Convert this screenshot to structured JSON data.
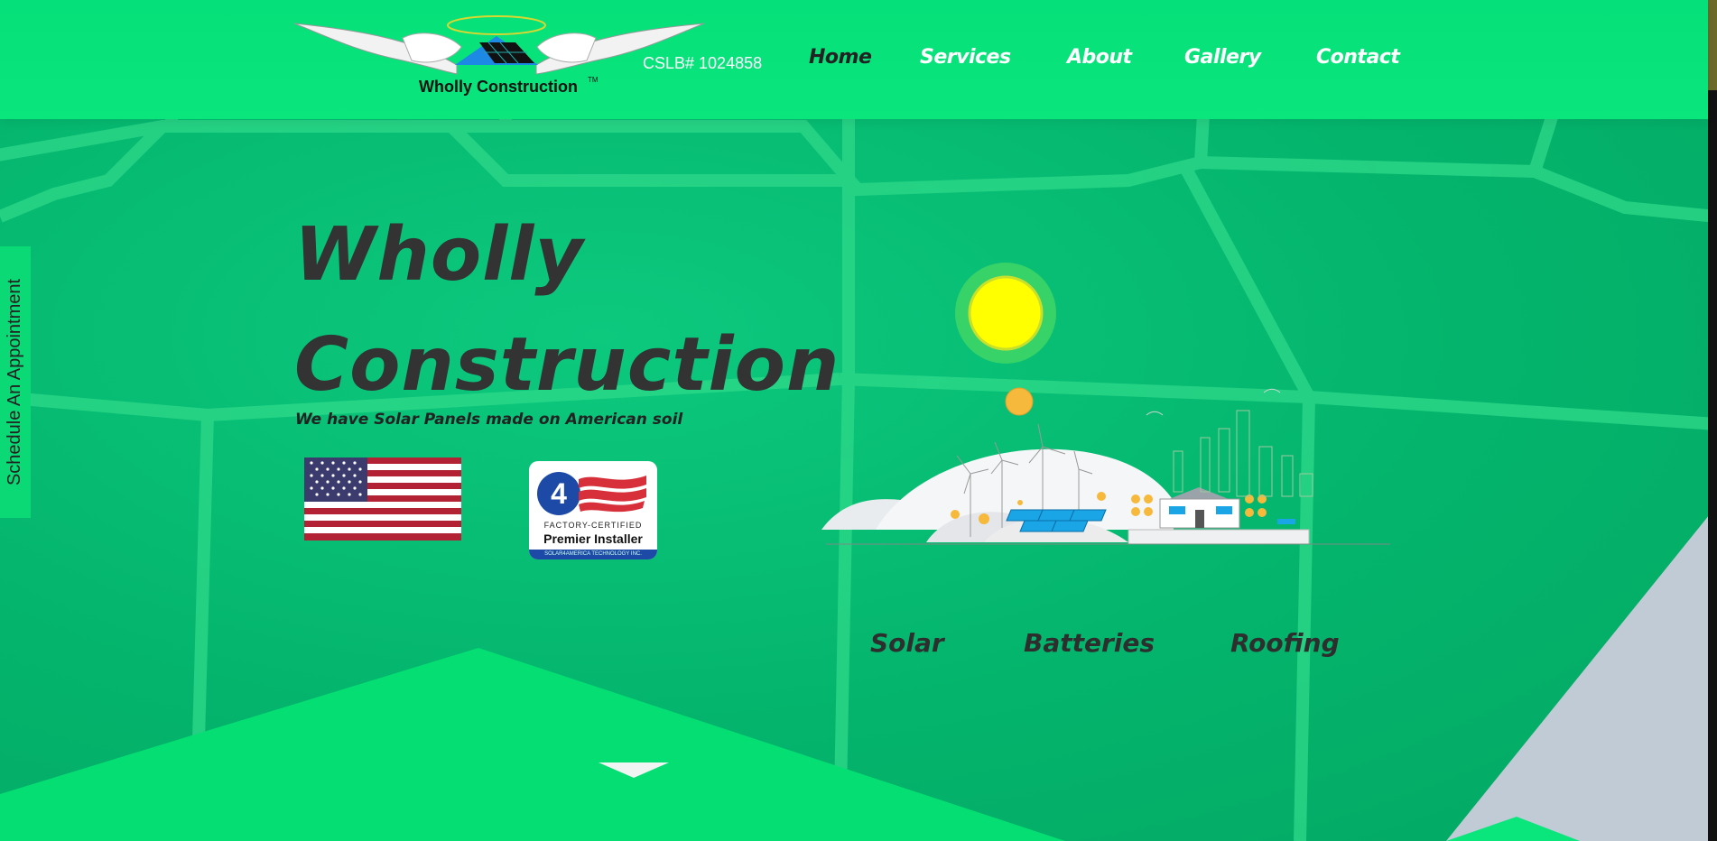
{
  "header": {
    "logo_text": "Wholly Construction",
    "logo_tm": "TM",
    "license": "CSLB# 1024858"
  },
  "nav": {
    "items": [
      {
        "label": "Home",
        "active": true
      },
      {
        "label": "Services",
        "active": false
      },
      {
        "label": "About",
        "active": false
      },
      {
        "label": "Gallery",
        "active": false
      },
      {
        "label": "Contact",
        "active": false
      }
    ]
  },
  "side_tab": {
    "label": "Schedule An Appointment"
  },
  "hero": {
    "title_line1": "Wholly",
    "title_line2": "Construction",
    "subtitle": "We have Solar Panels made on American soil"
  },
  "badge": {
    "line1": "FACTORY-CERTIFIED",
    "line2": "Premier Installer",
    "line3": "SOLAR4AMERICA TECHNOLOGY INC."
  },
  "services": [
    {
      "label": "Solar"
    },
    {
      "label": "Batteries"
    },
    {
      "label": "Roofing"
    }
  ],
  "colors": {
    "header": "#06e07a",
    "background": "#05b96f",
    "active_nav": "#222222",
    "nav": "#ffffff",
    "title": "#333333",
    "sun": "#ffff00"
  }
}
